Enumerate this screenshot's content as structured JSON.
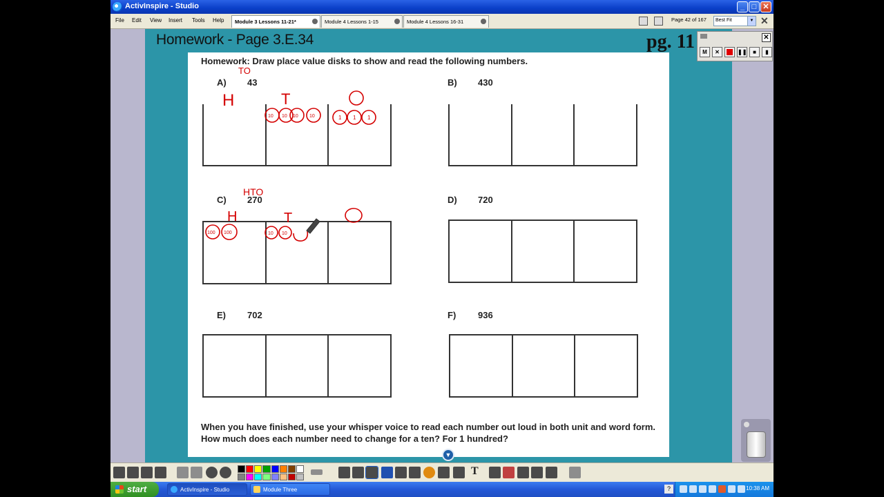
{
  "window": {
    "title": "ActivInspire - Studio",
    "minimize": "_",
    "maximize": "□",
    "close": "✕"
  },
  "menu": [
    "File",
    "Edit",
    "View",
    "Insert",
    "Tools",
    "Help"
  ],
  "tabs": [
    "Module 3 Lessons 11-21*",
    "Module 4 Lessons 1-15",
    "Module 4 Lessons 16-31"
  ],
  "pager": {
    "text": "Page 42 of 167",
    "zoom": "Best Fit"
  },
  "flipchart": {
    "title": "Homework - Page 3.E.34",
    "page_label": "pg. 11"
  },
  "worksheet": {
    "heading": "Homework:  Draw place value disks to show and read the following numbers.",
    "problems": [
      {
        "letter": "A)",
        "number": "43"
      },
      {
        "letter": "B)",
        "number": "430"
      },
      {
        "letter": "C)",
        "number": "270"
      },
      {
        "letter": "D)",
        "number": "720"
      },
      {
        "letter": "E)",
        "number": "702"
      },
      {
        "letter": "F)",
        "number": "936"
      }
    ],
    "footer": "When you have finished, use your whisper voice to read each number out loud in both unit and word form.  How much does each number need to change for a ten?  For 1 hundred?"
  },
  "annotations": {
    "color": "#d40000",
    "a_to": "TO",
    "a_places": [
      "H",
      "T",
      "O"
    ],
    "a_disks": [
      "10",
      "10",
      "10",
      "10",
      "1",
      "1",
      "1"
    ],
    "c_hto": "HTO",
    "c_places": [
      "H",
      "T",
      "O"
    ],
    "c_disks": [
      "100",
      "100",
      "10",
      "10"
    ]
  },
  "recorder": {
    "buttons": [
      "M",
      "✕",
      "",
      "❚❚",
      "■",
      "▮"
    ],
    "close": "✕"
  },
  "taskbar": {
    "start": "start",
    "tasks": [
      "ActivInspire - Studio",
      "Module Three"
    ],
    "help": "?",
    "clock": "10:38 AM"
  },
  "palette": [
    "#000000",
    "#ff0000",
    "#ffff00",
    "#00a000",
    "#0000ff",
    "#ff8000",
    "#804000",
    "#ffffff",
    "#808080",
    "#ff00ff",
    "#00ffff",
    "#80ff80",
    "#8080ff",
    "#ffc080",
    "#c00000",
    "#c0c0c0"
  ]
}
